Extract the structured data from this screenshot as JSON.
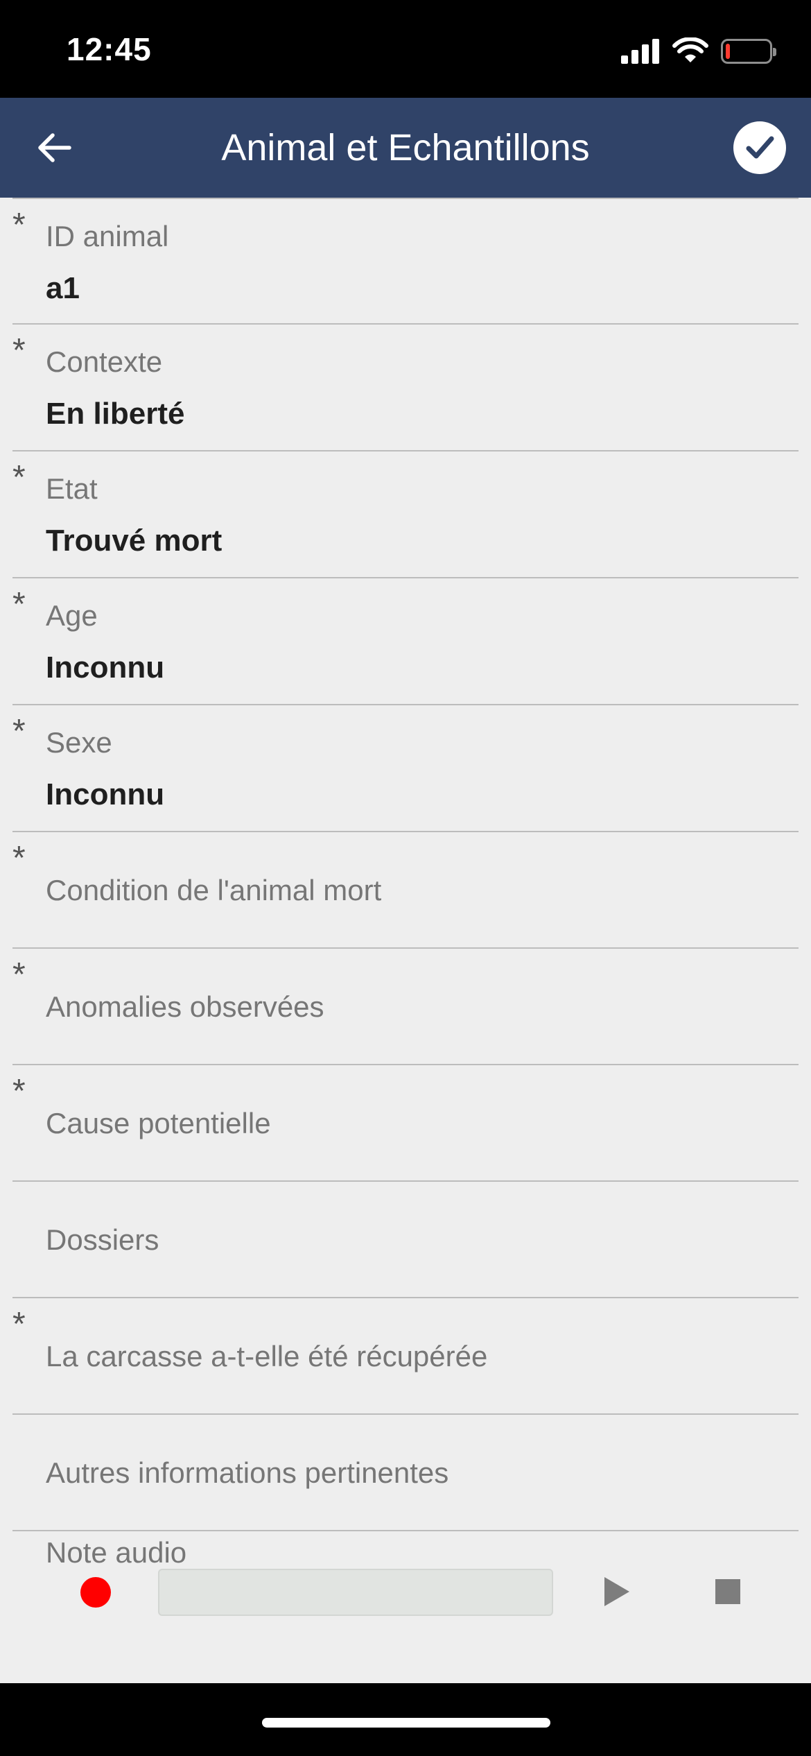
{
  "status_bar": {
    "time": "12:45",
    "battery_color": "#ff3b30"
  },
  "app_bar": {
    "title": "Animal et Echantillons",
    "background": "#304368",
    "back_icon": "arrow-left-icon",
    "confirm_icon": "check-circle-icon"
  },
  "form": {
    "required_marker": "*",
    "fields": [
      {
        "label": "ID animal",
        "value": "a1",
        "required": true
      },
      {
        "label": "Contexte",
        "value": "En liberté",
        "required": true
      },
      {
        "label": "Etat",
        "value": "Trouvé mort",
        "required": true
      },
      {
        "label": "Age",
        "value": "Inconnu",
        "required": true
      },
      {
        "label": "Sexe",
        "value": "Inconnu",
        "required": true
      },
      {
        "label": "Condition de l'animal mort",
        "value": "",
        "required": true
      },
      {
        "label": "Anomalies observées",
        "value": "",
        "required": true
      },
      {
        "label": "Cause potentielle",
        "value": "",
        "required": true
      },
      {
        "label": "Dossiers",
        "value": "",
        "required": false
      },
      {
        "label": "La carcasse a-t-elle été récupérée",
        "value": "",
        "required": true
      },
      {
        "label": "Autres informations pertinentes",
        "value": "",
        "required": false
      }
    ],
    "audio_note": {
      "label": "Note audio",
      "record_icon": "record-icon",
      "play_icon": "play-icon",
      "stop_icon": "stop-icon"
    }
  }
}
